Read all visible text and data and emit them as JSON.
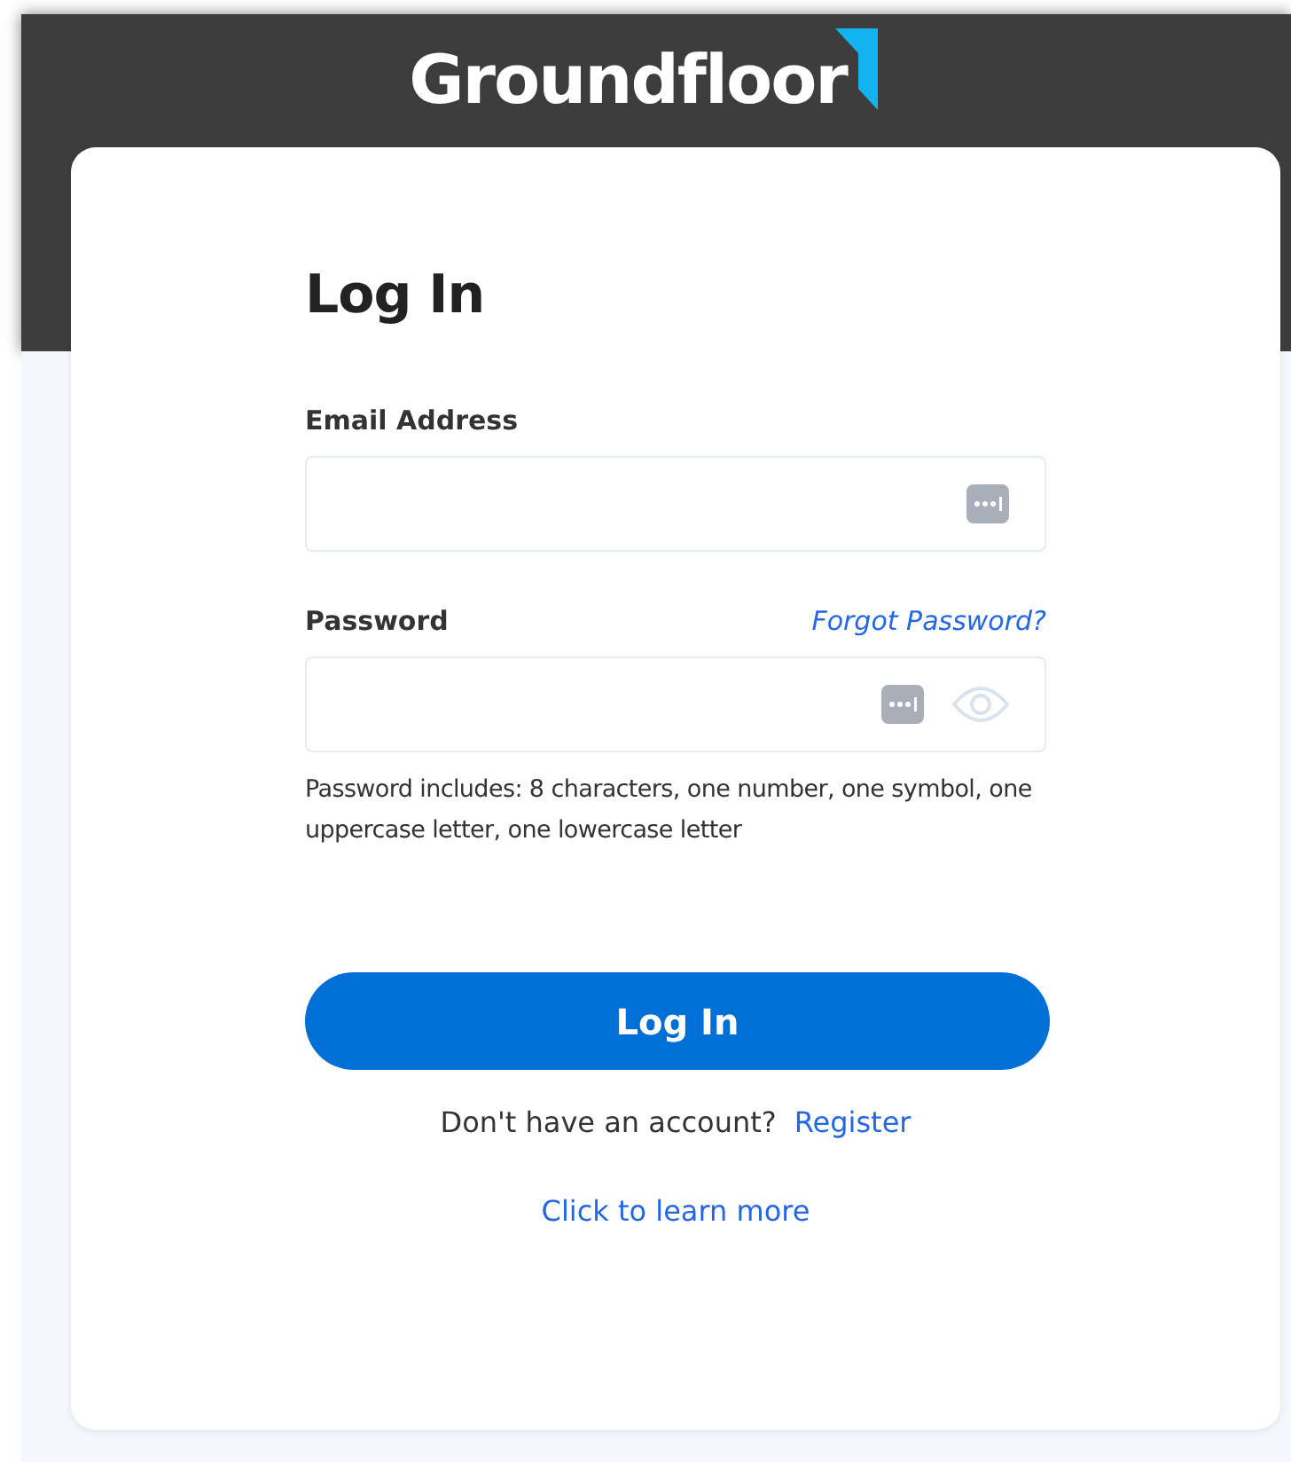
{
  "header": {
    "logo_text": "Groundfloor"
  },
  "form": {
    "title": "Log In",
    "fields": [
      {
        "kind": "email",
        "label": "Email Address"
      },
      {
        "kind": "password",
        "label": "Password",
        "link": "Forgot Password?"
      }
    ],
    "hint": "Password includes: 8 characters, one number, one symbol, one uppercase letter, one lowercase letter",
    "submit": "Log In",
    "register_prompt": "Don't have an account?",
    "register_link": "Register",
    "learn_more": "Click to learn more"
  }
}
